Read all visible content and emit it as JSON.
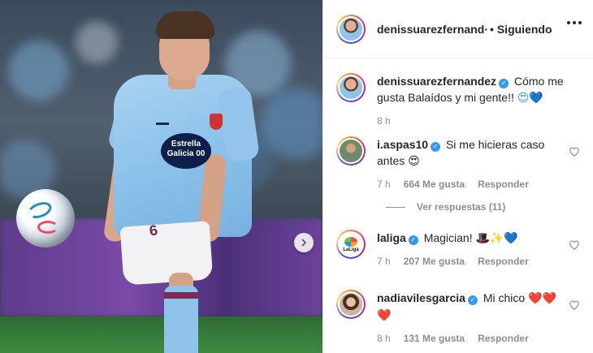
{
  "post": {
    "author": "denissuarezfernandez",
    "header_user": "denissuarezfernand·",
    "follow_label": "Siguiendo",
    "separator": "•"
  },
  "caption": {
    "user": "denissuarezfernandez",
    "text": "Cómo me gusta Balaídos y mi gente!!",
    "emojis": "😍💙",
    "time": "8 h"
  },
  "comments": [
    {
      "user": "i.aspas10",
      "text": "Si me hicieras caso antes",
      "emojis": "😍",
      "time": "7 h",
      "likes": "664 Me gusta",
      "reply": "Responder",
      "view_replies": "Ver respuestas (11)"
    },
    {
      "user": "laliga",
      "text": "Magician!",
      "emojis": "🎩✨💙",
      "time": "7 h",
      "likes": "207 Me gusta",
      "reply": "Responder",
      "avatar_text": "LaLiga"
    },
    {
      "user": "nadiavilesgarcia",
      "text": "Mi chico",
      "emojis": "❤️❤️❤️",
      "time": "8 h",
      "likes": "131 Me gusta",
      "reply": "Responder"
    }
  ],
  "photo": {
    "sponsor": "Estrella Galicia 00",
    "shorts_number": "6"
  },
  "colors": {
    "verified": "#3897f0",
    "meta_text": "#8e8e8e",
    "text": "#262626"
  }
}
